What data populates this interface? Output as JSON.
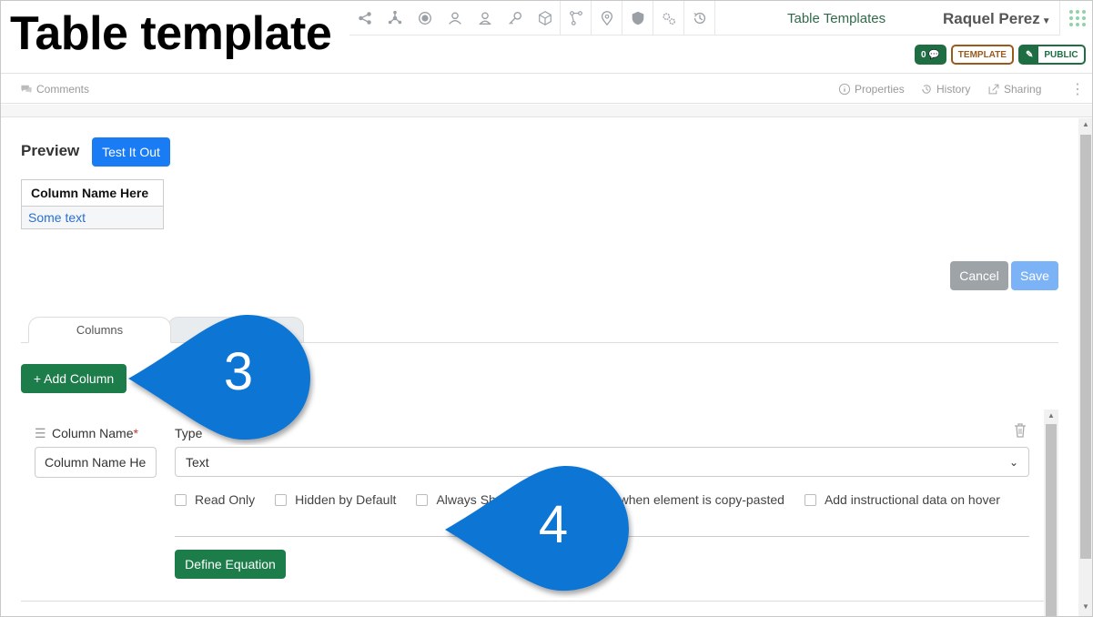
{
  "overlay_title": "Table template",
  "header": {
    "breadcrumb": "Table Templates",
    "user_name": "Raquel Perez",
    "icons": [
      "share-icon",
      "hub-icon",
      "record-icon",
      "users-icon",
      "user-icon",
      "key-icon",
      "box-icon",
      "branch-icon",
      "location-icon",
      "shield-icon",
      "settings-icon",
      "history-icon"
    ],
    "badges": {
      "count": "0",
      "template": "TEMPLATE",
      "public": "PUBLIC"
    }
  },
  "subbar": {
    "comments": "Comments",
    "properties": "Properties",
    "history": "History",
    "sharing": "Sharing"
  },
  "preview": {
    "label": "Preview",
    "test_button": "Test It Out",
    "table": {
      "header": "Column Name Here",
      "cell": "Some text"
    }
  },
  "actions": {
    "cancel": "Cancel",
    "save": "Save"
  },
  "tabs": [
    {
      "label": "Columns",
      "active": true
    },
    {
      "label": "",
      "active": false
    }
  ],
  "add_column_button": "+ Add Column",
  "column": {
    "name_label": "Column Name",
    "required_mark": "*",
    "name_value": "Column Name Here",
    "type_label": "Type",
    "type_value": "Text",
    "checkboxes": [
      {
        "label": "Read Only",
        "checked": false
      },
      {
        "label": "Hidden by Default",
        "checked": false
      },
      {
        "label": "Always Sho",
        "checked": false
      },
      {
        "label": "when element is copy-pasted",
        "checked": false
      },
      {
        "label": "Add instructional data on hover",
        "checked": false
      }
    ],
    "equation_button": "Define Equation"
  },
  "callouts": [
    {
      "number": "3",
      "color": "#0b74d4"
    },
    {
      "number": "4",
      "color": "#0b74d4"
    }
  ],
  "colors": {
    "primary_blue": "#1a7cf5",
    "green": "#1c7d4a",
    "template_brown": "#9a5a1c"
  }
}
